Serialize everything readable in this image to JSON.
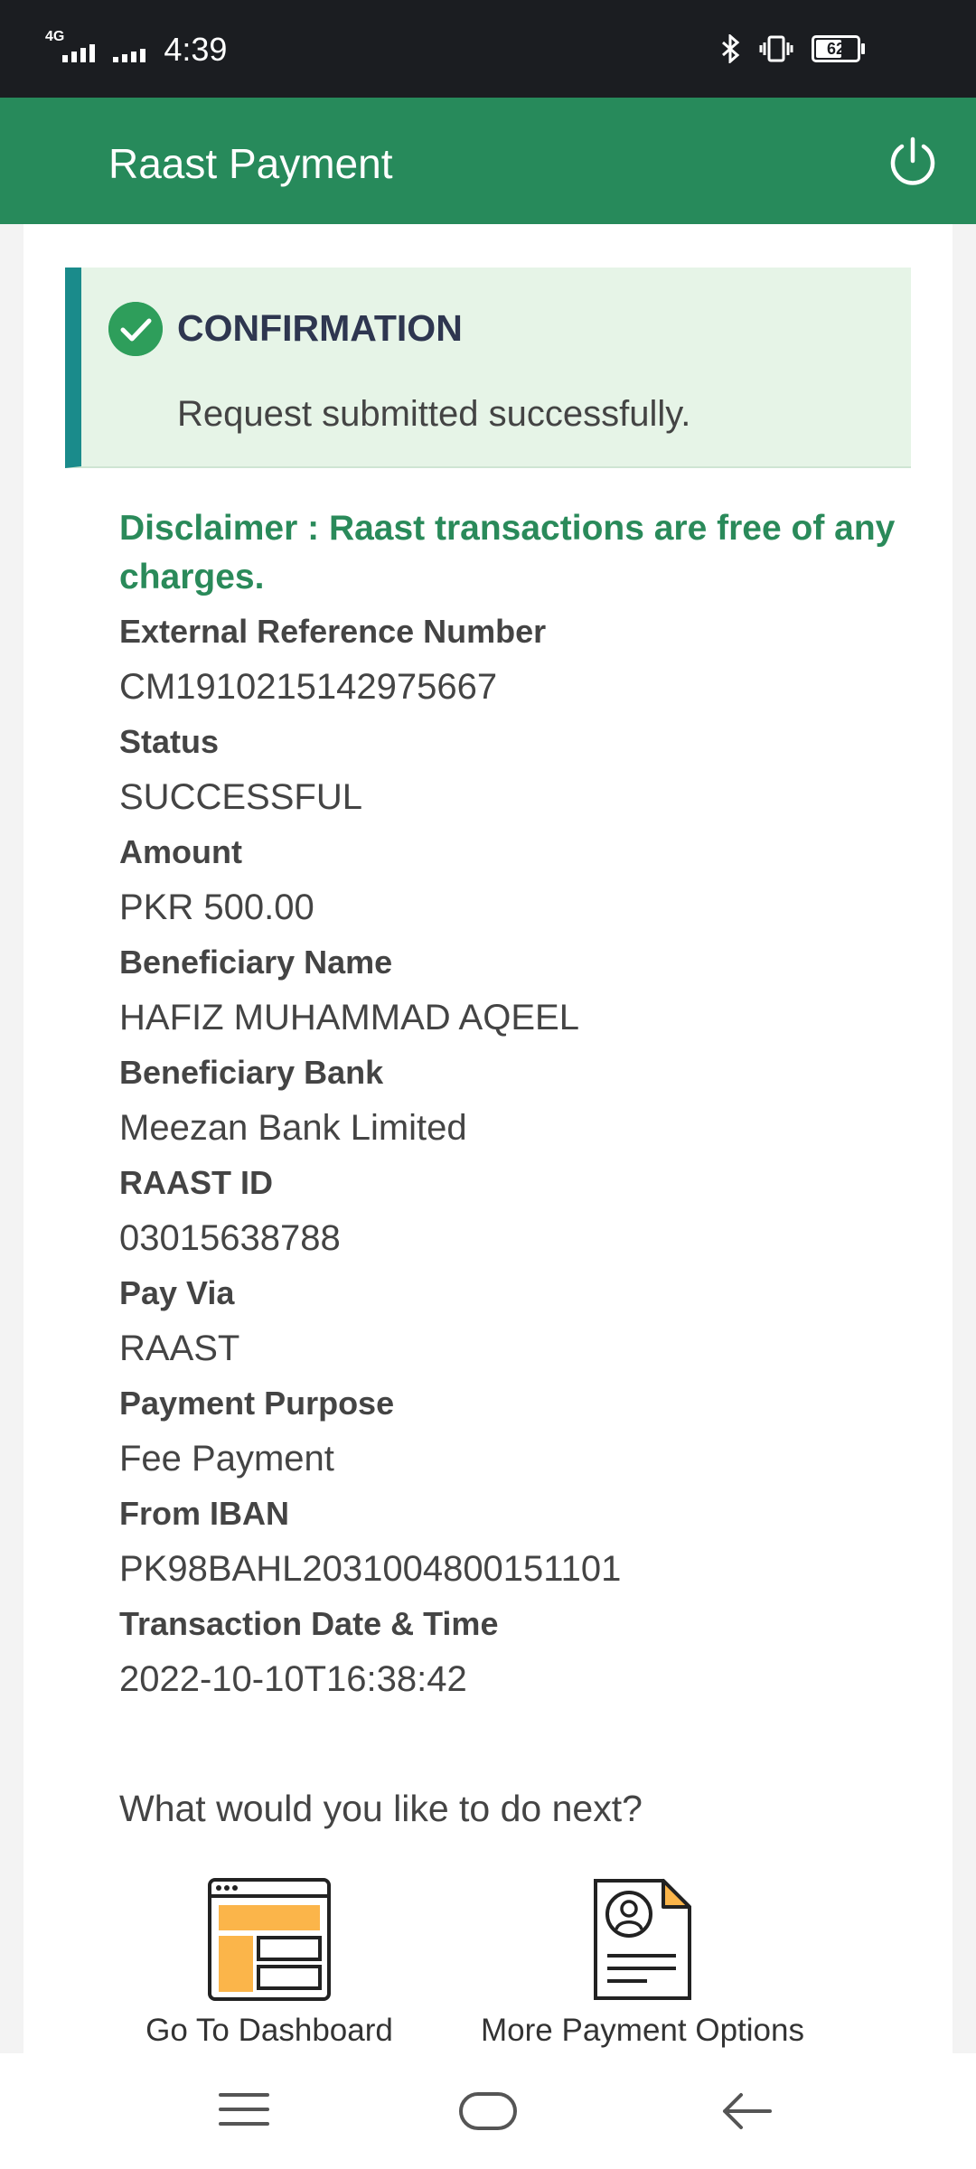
{
  "status_bar": {
    "network": "4G",
    "time": "4:39",
    "battery": "62"
  },
  "app_bar": {
    "title": "Raast Payment",
    "power_icon": "power-icon"
  },
  "confirmation": {
    "heading": "CONFIRMATION",
    "message": "Request submitted successfully.",
    "icon": "check-circle-icon"
  },
  "disclaimer": "Disclaimer : Raast transactions are free of any charges.",
  "details": [
    {
      "label": "External Reference Number",
      "value": "CM1910215142975667"
    },
    {
      "label": "Status",
      "value": "SUCCESSFUL"
    },
    {
      "label": "Amount",
      "value": "PKR 500.00"
    },
    {
      "label": "Beneficiary Name",
      "value": "HAFIZ MUHAMMAD AQEEL"
    },
    {
      "label": "Beneficiary Bank",
      "value": "Meezan Bank Limited"
    },
    {
      "label": "RAAST ID",
      "value": "03015638788"
    },
    {
      "label": "Pay Via",
      "value": "RAAST"
    },
    {
      "label": "Payment Purpose",
      "value": "Fee Payment"
    },
    {
      "label": "From IBAN",
      "value": "PK98BAHL2031004800151101"
    },
    {
      "label": "Transaction Date & Time",
      "value": "2022-10-10T16:38:42"
    }
  ],
  "next_prompt": "What would you like to do next?",
  "actions": {
    "dashboard": {
      "label": "Go To Dashboard",
      "icon": "dashboard-icon"
    },
    "more_payments": {
      "label": "More Payment Options",
      "icon": "document-profile-icon"
    }
  },
  "colors": {
    "brand_green": "#278a5b",
    "confirm_bg": "#e6f4e7",
    "accent_orange": "#fbb54a"
  }
}
